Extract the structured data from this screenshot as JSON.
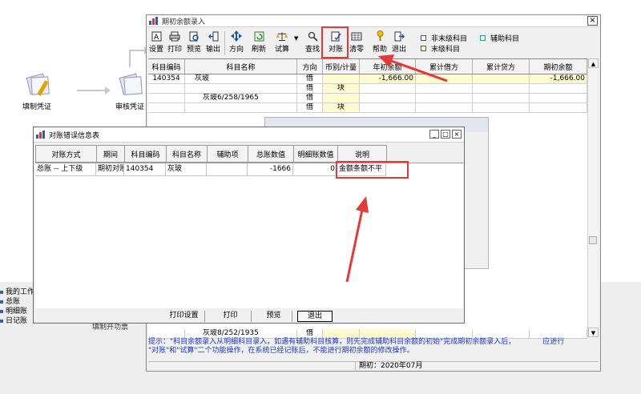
{
  "desktop": {
    "icon1_label": "填制凭证",
    "icon2_label": "审核凭证",
    "side_links": [
      "我的工作",
      "总账",
      "明细账",
      "日记账"
    ],
    "bg_function": "填制开功票"
  },
  "main_window": {
    "title": "期初余额录入",
    "close_glyph": "×",
    "toolbar": [
      {
        "label": "设置",
        "icon": "settings-icon"
      },
      {
        "label": "打印",
        "icon": "printer-icon"
      },
      {
        "label": "预览",
        "icon": "preview-icon"
      },
      {
        "label": "输出",
        "icon": "export-icon"
      },
      {
        "label": "方向",
        "icon": "direction-icon"
      },
      {
        "label": "刷新",
        "icon": "refresh-icon"
      },
      {
        "label": "试算",
        "icon": "balance-scale-icon"
      },
      {
        "label": "查找",
        "icon": "find-icon"
      },
      {
        "label": "对账",
        "icon": "reconcile-icon"
      },
      {
        "label": "清零",
        "icon": "clear-icon"
      },
      {
        "label": "帮助",
        "icon": "help-icon"
      },
      {
        "label": "退出",
        "icon": "exit-icon"
      }
    ],
    "legend": {
      "non_leaf": "非末级科目",
      "auxiliary": "辅助科目",
      "leaf": "末级科目"
    },
    "columns": [
      "科目编码",
      "科目名称",
      "方向",
      "币别/计量",
      "年初余额",
      "累计借方",
      "累计贷方",
      "期初余额"
    ],
    "rows": [
      {
        "code": "140354",
        "name": "灰玻",
        "dir": "借",
        "unit": "",
        "opening_year": "-1,666.00",
        "debit": "",
        "credit": "",
        "opening": "-1,666.00"
      },
      {
        "code": "",
        "name": "",
        "dir": "借",
        "unit": "块",
        "opening_year": "",
        "debit": "",
        "credit": "",
        "opening": ""
      },
      {
        "code": "",
        "name": "灰玻6/258/1965",
        "dir": "借",
        "unit": "",
        "opening_year": "",
        "debit": "",
        "credit": "",
        "opening": ""
      },
      {
        "code": "",
        "name": "",
        "dir": "借",
        "unit": "块",
        "opening_year": "",
        "debit": "",
        "credit": "",
        "opening": ""
      },
      {
        "code": "",
        "name": "灰玻8/252/1935",
        "dir": "借",
        "unit": "",
        "opening_year": "",
        "debit": "",
        "credit": "",
        "opening": ""
      }
    ],
    "hint_line1": "提示：\"科目余额录入从明细科目录入，如遇有辅助科目核算，则先完成辅助科目余额的初始\"完成期初余额录入后，",
    "hint_line1_tail": "应进行",
    "hint_line2": "\"对账\"和\"试算\"二个功能操作，在系统已经记账后，不能进行期初余额的修改操作。",
    "status_period": "期初：2020年07月",
    "scroll_up": "▲",
    "scroll_down": "▼"
  },
  "error_dialog": {
    "title": "对账错误信息表",
    "win_min": "_",
    "win_max": "□",
    "win_close": "×",
    "columns": [
      "对账方式",
      "期间",
      "科目编码",
      "科目名称",
      "辅助项",
      "总账数值",
      "明细账数值",
      "说明"
    ],
    "rows": [
      {
        "method": "总账 -- 上下级",
        "period": "期初对账",
        "code": "140354",
        "name": "灰玻",
        "aux": "",
        "ledger": "-1666",
        "detail": "0",
        "note": "金额条额不平"
      }
    ],
    "buttons": [
      "打印设置",
      "打印",
      "预览",
      "退出"
    ]
  },
  "colors": {
    "highlight": "#e53935",
    "hint_text": "#1a36c8",
    "leaf_legend": "#fffacd",
    "aux_legend": "#e0f7f5",
    "row_yellow": "#fffbd0"
  }
}
